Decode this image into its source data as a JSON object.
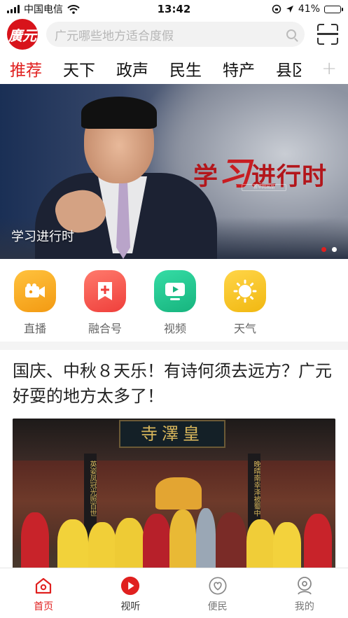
{
  "status_bar": {
    "carrier": "中国电信",
    "time": "13:42",
    "battery": "41%",
    "battery_level": 0.41
  },
  "header": {
    "logo_text": "廣元",
    "search_placeholder": "广元哪些地方适合度假",
    "icons": [
      "search-icon",
      "scan-icon"
    ]
  },
  "tabs": [
    {
      "label": "推荐",
      "active": true
    },
    {
      "label": "天下",
      "active": false
    },
    {
      "label": "政声",
      "active": false
    },
    {
      "label": "民生",
      "active": false
    },
    {
      "label": "特产",
      "active": false
    },
    {
      "label": "县区",
      "active": false
    }
  ],
  "tabs_add_label": "+",
  "banner": {
    "slogan_1": "学",
    "slogan_2": "习",
    "slogan_3": "进行时",
    "sub_badge": "新华网出品",
    "caption": "学习进行时",
    "dots": 2,
    "active_dot": 0
  },
  "quick_entries": [
    {
      "label": "直播",
      "icon": "video-camera-icon",
      "color": "#f5a316"
    },
    {
      "label": "融合号",
      "icon": "bookmark-plus-icon",
      "color": "#f2524b"
    },
    {
      "label": "视频",
      "icon": "tv-play-icon",
      "color": "#22c28e"
    },
    {
      "label": "天气",
      "icon": "sun-icon",
      "color": "#f3c324"
    }
  ],
  "article": {
    "title": "国庆、中秋８天乐！有诗何须去远方？广元好耍的地方太多了！",
    "plaque_text": "寺澤皇",
    "couplet_left": "英姿凤冠光照百世",
    "couplet_right": "晚晴南幸泽被蜀中"
  },
  "bottom_nav": [
    {
      "label": "首页",
      "icon": "home-icon",
      "active": true
    },
    {
      "label": "视听",
      "icon": "play-circle-icon",
      "active": false
    },
    {
      "label": "便民",
      "icon": "heart-hands-icon",
      "active": false
    },
    {
      "label": "我的",
      "icon": "user-icon",
      "active": false
    }
  ],
  "colors": {
    "accent": "#e0201f",
    "brand_red": "#d8131b"
  }
}
